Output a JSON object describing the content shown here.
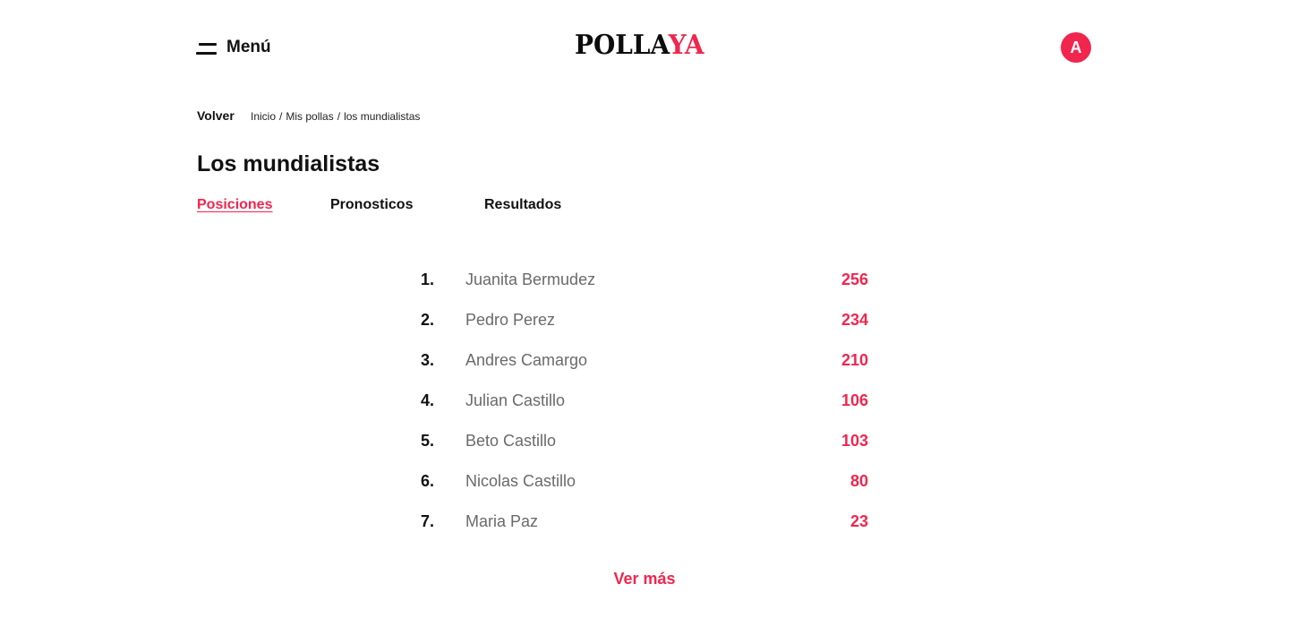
{
  "header": {
    "menu_label": "Menú",
    "logo_dark": "POLLA",
    "logo_accent": "YA",
    "avatar_initial": "A"
  },
  "nav": {
    "back_label": "Volver",
    "breadcrumb": [
      "Inicio",
      "Mis pollas",
      "los mundialistas"
    ],
    "separator": "/"
  },
  "page_title": "Los mundialistas",
  "tabs": [
    {
      "label": "Posiciones",
      "active": true
    },
    {
      "label": "Pronosticos",
      "active": false
    },
    {
      "label": "Resultados",
      "active": false
    }
  ],
  "standings": [
    {
      "position": "1.",
      "name": "Juanita Bermudez",
      "points": "256"
    },
    {
      "position": "2.",
      "name": "Pedro Perez",
      "points": "234"
    },
    {
      "position": "3.",
      "name": "Andres Camargo",
      "points": "210"
    },
    {
      "position": "4.",
      "name": "Julian Castillo",
      "points": "106"
    },
    {
      "position": "5.",
      "name": "Beto Castillo",
      "points": "103"
    },
    {
      "position": "6.",
      "name": "Nicolas Castillo",
      "points": "80"
    },
    {
      "position": "7.",
      "name": "Maria Paz",
      "points": "23"
    }
  ],
  "see_more_label": "Ver más",
  "colors": {
    "accent": "#f0264e",
    "text": "#111111",
    "muted": "#6a6a6a"
  }
}
